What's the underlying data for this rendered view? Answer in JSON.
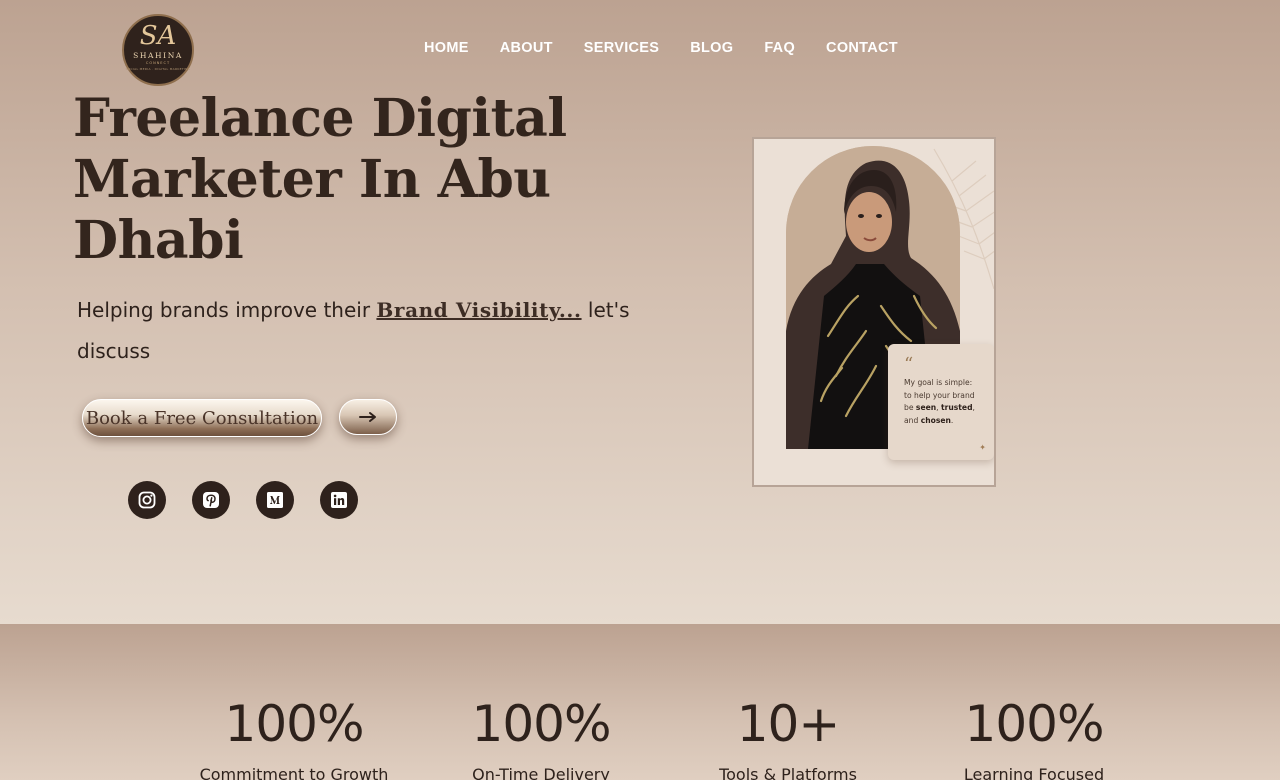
{
  "logo": {
    "mark": "SA",
    "name": "SHAHINA",
    "sub": "CONNECT",
    "tagline": "SOCIAL MEDIA · DIGITAL MARKETING"
  },
  "nav": {
    "items": [
      "HOME",
      "ABOUT",
      "SERVICES",
      "BLOG",
      "FAQ",
      "CONTACT"
    ]
  },
  "hero": {
    "title": "Freelance Digital Marketer In Abu Dhabi",
    "subtitle_pre": "Helping brands improve their",
    "subtitle_highlight": "Brand Visibility...",
    "subtitle_post": "let's discuss",
    "cta_label": "Book a Free Consultation",
    "arrow_icon": "arrow-right-icon"
  },
  "social": [
    "instagram-icon",
    "pinterest-icon",
    "medium-icon",
    "linkedin-icon"
  ],
  "quote_card": {
    "mark": "“",
    "line1": "My goal is simple:",
    "line2": "to help your brand",
    "line3_pre": "be",
    "seen": "seen",
    "trusted": "trusted",
    "line4_pre": "and",
    "chosen": "chosen",
    "sparkle": "✦"
  },
  "stats": [
    {
      "value": "100%",
      "label": "Commitment to Growth"
    },
    {
      "value": "100%",
      "label": "On-Time Delivery"
    },
    {
      "value": "10+",
      "label": "Tools & Platforms"
    },
    {
      "value": "100%",
      "label": "Learning Focused"
    }
  ],
  "colors": {
    "accent": "#2e211c",
    "gold": "#c9a27a"
  }
}
